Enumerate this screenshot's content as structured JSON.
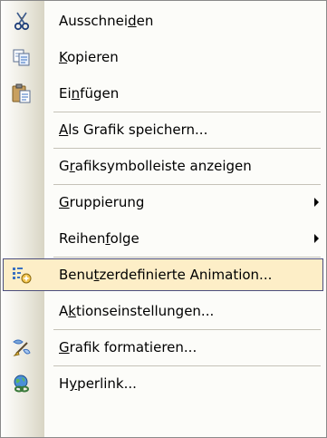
{
  "menu": {
    "items": [
      {
        "icon": "scissors-icon",
        "label": {
          "pre": "Ausschnei",
          "key": "d",
          "post": "en"
        }
      },
      {
        "icon": "copy-icon",
        "label": {
          "pre": "",
          "key": "K",
          "post": "opieren"
        }
      },
      {
        "icon": "paste-icon",
        "label": {
          "pre": "Ei",
          "key": "n",
          "post": "fügen"
        }
      },
      {
        "icon": "",
        "label": {
          "pre": "",
          "key": "A",
          "post": "ls Grafik speichern..."
        }
      },
      {
        "icon": "",
        "label": {
          "pre": "G",
          "key": "r",
          "post": "afiksymbolleiste anzeigen"
        }
      },
      {
        "icon": "",
        "label": {
          "pre": "",
          "key": "G",
          "post": "ruppierung"
        },
        "submenu": true
      },
      {
        "icon": "",
        "label": {
          "pre": "Reihen",
          "key": "f",
          "post": "olge"
        },
        "submenu": true
      },
      {
        "icon": "custom-animation-icon",
        "label": {
          "pre": "Benu",
          "key": "t",
          "post": "zerdefinierte Animation..."
        },
        "highlighted": true
      },
      {
        "icon": "",
        "label": {
          "pre": "A",
          "key": "k",
          "post": "tionseinstellungen..."
        }
      },
      {
        "icon": "format-picture-icon",
        "label": {
          "pre": "",
          "key": "G",
          "post": "rafik formatieren..."
        }
      },
      {
        "icon": "hyperlink-icon",
        "label": {
          "pre": "H",
          "key": "y",
          "post": "perlink..."
        }
      }
    ]
  },
  "colors": {
    "highlight_bg": "#fdeec7",
    "highlight_border": "#4b4e7e",
    "gutter": "#e3e1d5"
  }
}
